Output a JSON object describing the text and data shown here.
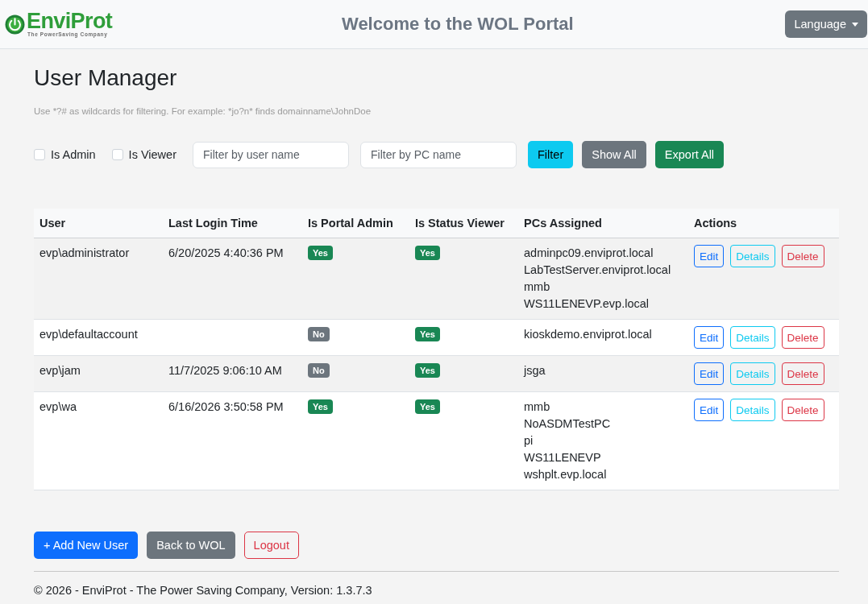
{
  "header": {
    "logo": {
      "name": "EnviProt",
      "tagline": "The PowerSaving Company"
    },
    "title": "Welcome to the WOL Portal",
    "language_button": "Language"
  },
  "page": {
    "heading": "User Manager",
    "hint": "Use *?# as wildcards for filtering. For example: *jo?n* finds domainname\\JohnDoe"
  },
  "filters": {
    "checkboxes": [
      {
        "label": "Is Admin",
        "checked": false
      },
      {
        "label": "Is Viewer",
        "checked": false
      }
    ],
    "fields": [
      {
        "placeholder": "Filter by user name"
      },
      {
        "placeholder": "Filter by PC name"
      }
    ],
    "buttons": [
      {
        "label": "Filter",
        "kind": "info"
      },
      {
        "label": "Show All",
        "kind": "secondary"
      },
      {
        "label": "Export All",
        "kind": "success"
      }
    ]
  },
  "table": {
    "columns": [
      "User",
      "Last Login Time",
      "Is Portal Admin",
      "Is Status Viewer",
      "PCs Assigned",
      "Actions"
    ],
    "rows": [
      {
        "user": "evp\\administrator",
        "last_login": "6/20/2025 4:40:36 PM",
        "portal_admin": {
          "label": "Yes",
          "on": true
        },
        "status_viewer": {
          "label": "Yes",
          "on": true
        },
        "pcs": [
          "adminpc09.enviprot.local",
          "LabTestServer.enviprot.local",
          "mmb",
          "WS11LENEVP.evp.local"
        ],
        "actions": [
          {
            "label": "Edit",
            "kind": "primary"
          },
          {
            "label": "Details",
            "kind": "info"
          },
          {
            "label": "Delete",
            "kind": "danger"
          }
        ]
      },
      {
        "user": "evp\\defaultaccount",
        "portal_admin": {
          "label": "No",
          "on": false
        },
        "status_viewer": {
          "label": "Yes",
          "on": true
        },
        "pcs": [
          "kioskdemo.enviprot.local"
        ],
        "actions": [
          {
            "label": "Edit",
            "kind": "primary"
          },
          {
            "label": "Details",
            "kind": "info"
          },
          {
            "label": "Delete",
            "kind": "danger"
          }
        ]
      },
      {
        "user": "evp\\jam",
        "last_login": "11/7/2025 9:06:10 AM",
        "portal_admin": {
          "label": "No",
          "on": false
        },
        "status_viewer": {
          "label": "Yes",
          "on": true
        },
        "pcs": [
          "jsga"
        ],
        "actions": [
          {
            "label": "Edit",
            "kind": "primary"
          },
          {
            "label": "Details",
            "kind": "info"
          },
          {
            "label": "Delete",
            "kind": "danger"
          }
        ]
      },
      {
        "user": "evp\\wa",
        "last_login": "6/16/2026 3:50:58 PM",
        "portal_admin": {
          "label": "Yes",
          "on": true
        },
        "status_viewer": {
          "label": "Yes",
          "on": true
        },
        "pcs": [
          "mmb",
          "NoASDMTestPC",
          "pi",
          "WS11LENEVP",
          "wshplt.evp.local"
        ],
        "actions": [
          {
            "label": "Edit",
            "kind": "primary"
          },
          {
            "label": "Details",
            "kind": "info"
          },
          {
            "label": "Delete",
            "kind": "danger"
          }
        ]
      }
    ]
  },
  "footer_buttons": [
    {
      "label": "+ Add New User",
      "kind": "primary"
    },
    {
      "label": "Back to WOL",
      "kind": "secondary"
    },
    {
      "label": "Logout",
      "kind": "danger"
    }
  ],
  "footer": {
    "copyright": "© 2026 - EnviProt - The Power Saving Company, Version: 1.3.7.3"
  }
}
